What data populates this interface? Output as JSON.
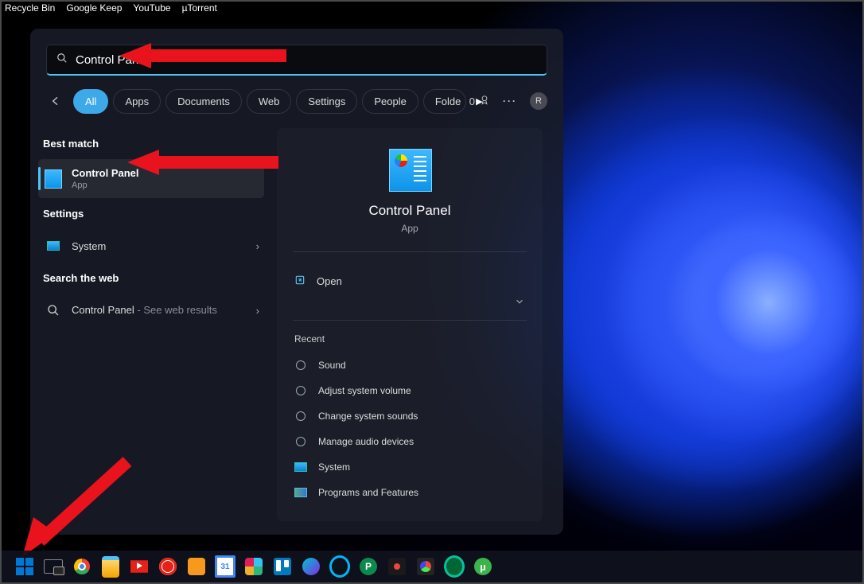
{
  "desktop": {
    "icons": [
      "Recycle Bin",
      "Google Keep",
      "YouTube",
      "µTorrent"
    ]
  },
  "search": {
    "query": "Control Panel",
    "filters": {
      "active": "All",
      "items": [
        "All",
        "Apps",
        "Documents",
        "Web",
        "Settings",
        "People",
        "Folde"
      ]
    },
    "rewards_points": "0",
    "avatar_initial": "R",
    "sections": {
      "best_match_head": "Best match",
      "best_match": {
        "title": "Control Panel",
        "subtitle": "App"
      },
      "settings_head": "Settings",
      "settings_item": "System",
      "web_head": "Search the web",
      "web_item_title": "Control Panel",
      "web_item_suffix": " - See web results"
    },
    "details": {
      "title": "Control Panel",
      "subtitle": "App",
      "open_label": "Open",
      "recent_head": "Recent",
      "recent": [
        "Sound",
        "Adjust system volume",
        "Change system sounds",
        "Manage audio devices",
        "System",
        "Programs and Features"
      ]
    }
  }
}
